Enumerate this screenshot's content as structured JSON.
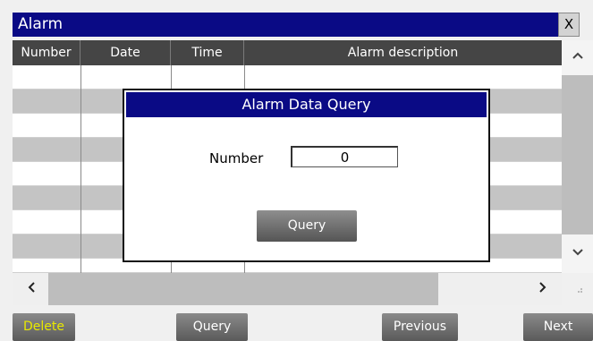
{
  "window": {
    "title": "Alarm",
    "close_label": "X"
  },
  "table": {
    "columns": [
      "Number",
      "Date",
      "Time",
      "Alarm description"
    ]
  },
  "scroll": {
    "up": "^",
    "down": "v",
    "left": "<",
    "right": ">"
  },
  "buttons": {
    "delete": "Delete",
    "query": "Query",
    "previous": "Previous",
    "next": "Next"
  },
  "dialog": {
    "title": "Alarm Data Query",
    "number_label": "Number",
    "number_value": "0",
    "query_button": "Query"
  },
  "colors": {
    "title_bar": "#0a0a85",
    "header": "#454545",
    "delete_text": "#e8e800"
  }
}
